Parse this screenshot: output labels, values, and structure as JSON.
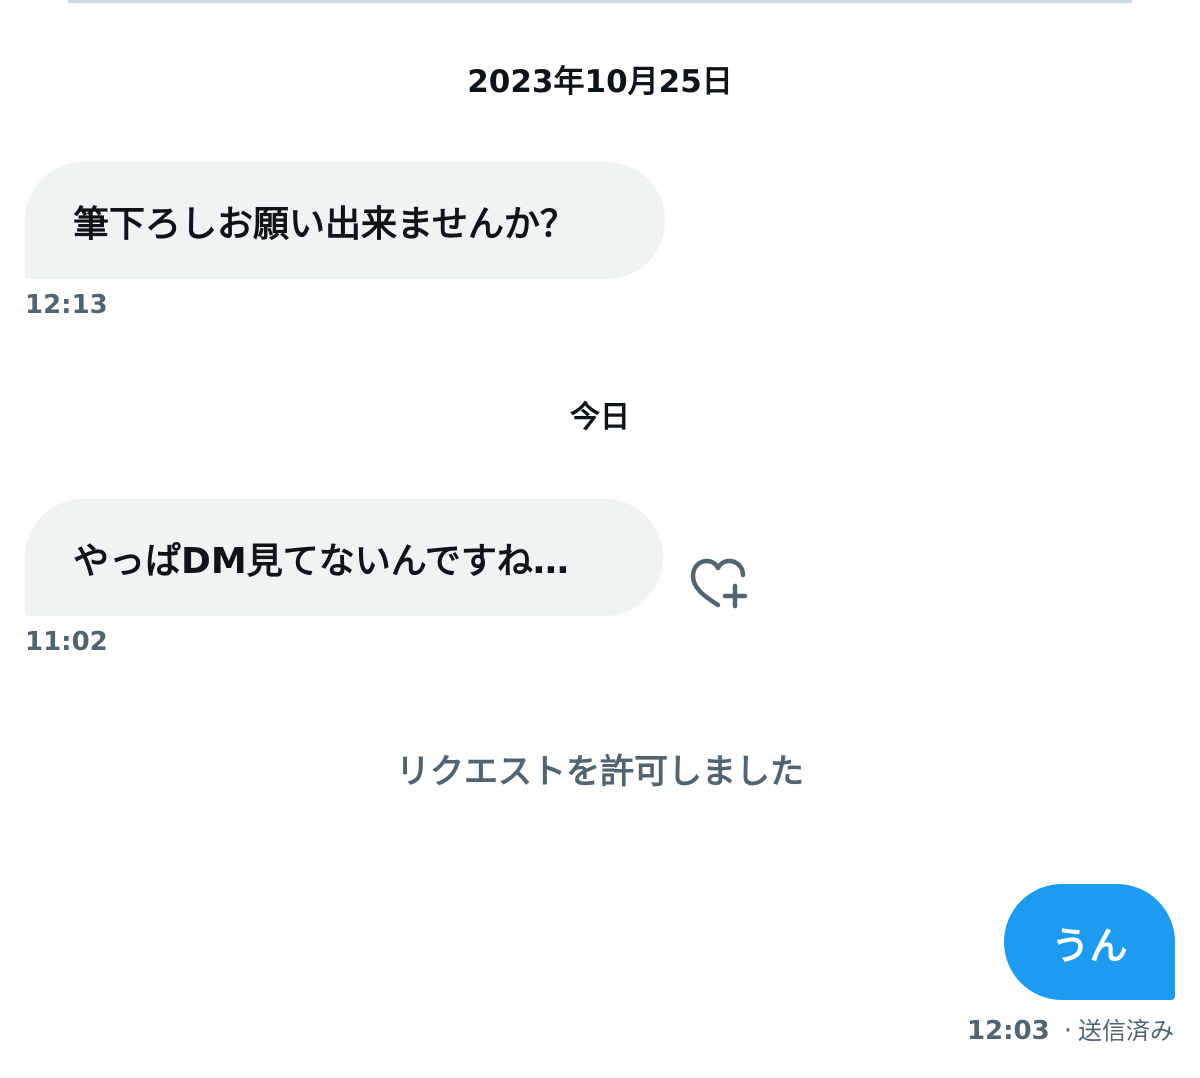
{
  "conversation": {
    "date_separators": [
      "2023年10月25日",
      "今日"
    ],
    "messages": [
      {
        "direction": "incoming",
        "text": "筆下ろしお願い出来ませんか？",
        "time": "12:13"
      },
      {
        "direction": "incoming",
        "text": "やっぱDM見てないんですね…",
        "time": "11:02",
        "reaction_icon": "heart-plus-icon"
      },
      {
        "direction": "outgoing",
        "text": "うん",
        "time": "12:03",
        "separator": "·",
        "status": "送信済み"
      }
    ],
    "system_notice": "リクエストを許可しました"
  },
  "colors": {
    "incoming_bubble": "#eff3f4",
    "outgoing_bubble": "#1d9bf0",
    "secondary_text": "#536471",
    "primary_text": "#0f1419"
  }
}
